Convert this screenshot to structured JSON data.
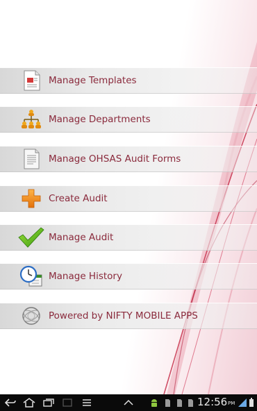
{
  "menu": {
    "items": [
      {
        "label": "Manage Templates",
        "icon": "templates-document-icon"
      },
      {
        "label": "Manage Departments",
        "icon": "org-chart-icon"
      },
      {
        "label": "Manage OHSAS Audit Forms",
        "icon": "audit-form-icon"
      },
      {
        "label": "Create Audit",
        "icon": "plus-icon"
      },
      {
        "label": "Manage Audit",
        "icon": "checkmark-icon"
      },
      {
        "label": "Manage History",
        "icon": "clock-calendar-icon"
      },
      {
        "label": "Powered by NIFTY MOBILE APPS",
        "icon": "globe-swirl-icon"
      }
    ]
  },
  "status_bar": {
    "time": "12:56",
    "ampm": "PM"
  },
  "colors": {
    "label": "#8a2a3c",
    "swoosh": "#c8324e",
    "navbar": "#0a0a0a"
  }
}
